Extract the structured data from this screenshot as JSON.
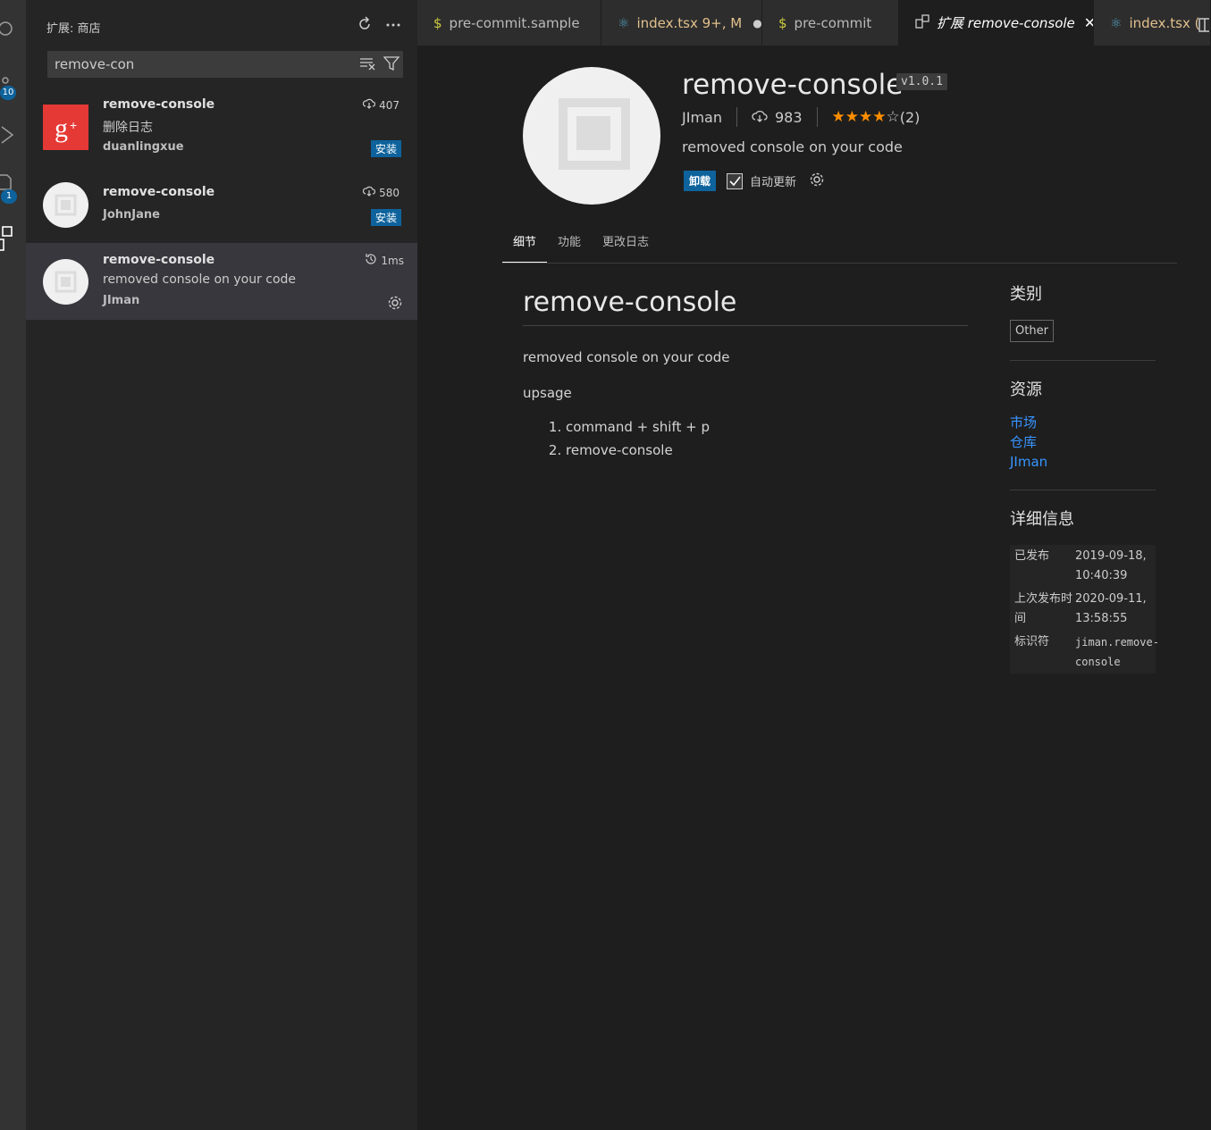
{
  "activity_bar": {
    "scm_badge": "10",
    "explorer_badge": "1"
  },
  "sidebar": {
    "title": "扩展: 商店",
    "search_value": "remove-con",
    "items": [
      {
        "name": "remove-console",
        "description": "删除日志",
        "author": "duanlingxue",
        "count": "407",
        "install_label": "安装"
      },
      {
        "name": "remove-console",
        "description": "",
        "author": "JohnJane",
        "count": "580",
        "install_label": "安装"
      },
      {
        "name": "remove-console",
        "description": "removed console on your code",
        "author": "JIman",
        "count": "1ms"
      }
    ]
  },
  "tabs": [
    {
      "label": "pre-commit.sample",
      "icon": "$"
    },
    {
      "label": "index.tsx  9+, M",
      "icon": "react-icon"
    },
    {
      "label": "pre-commit",
      "icon": "$"
    },
    {
      "label": "扩展 remove-console",
      "icon": "extensions-icon"
    },
    {
      "label": "index.tsx (",
      "icon": "react-icon"
    }
  ],
  "extension": {
    "name": "remove-console",
    "version": "v1.0.1",
    "publisher": "JIman",
    "installs": "983",
    "rating_count": "(2)",
    "rating": 4,
    "description": "removed console on your code",
    "uninstall_label": "卸载",
    "auto_update_label": "自动更新",
    "detail_tabs": [
      "细节",
      "功能",
      "更改日志"
    ]
  },
  "readme": {
    "heading": "remove-console",
    "para1": "removed console on your code",
    "para2": "upsage",
    "steps": [
      "command + shift + p",
      "remove-console"
    ]
  },
  "side": {
    "categories_title": "类别",
    "category": "Other",
    "resources_title": "资源",
    "links": [
      "市场",
      "仓库",
      "JIman"
    ],
    "details_title": "详细信息",
    "info": [
      {
        "key": "已发布",
        "value": "2019-09-18, 10:40:39"
      },
      {
        "key": "上次发布时间",
        "value": "2020-09-11, 13:58:55"
      },
      {
        "key": "标识符",
        "value": "jiman.remove-console"
      }
    ]
  },
  "colors": {
    "accent": "#0e639c",
    "star": "#ff8e00",
    "link": "#3794ff",
    "modified": "#e2c08d"
  }
}
